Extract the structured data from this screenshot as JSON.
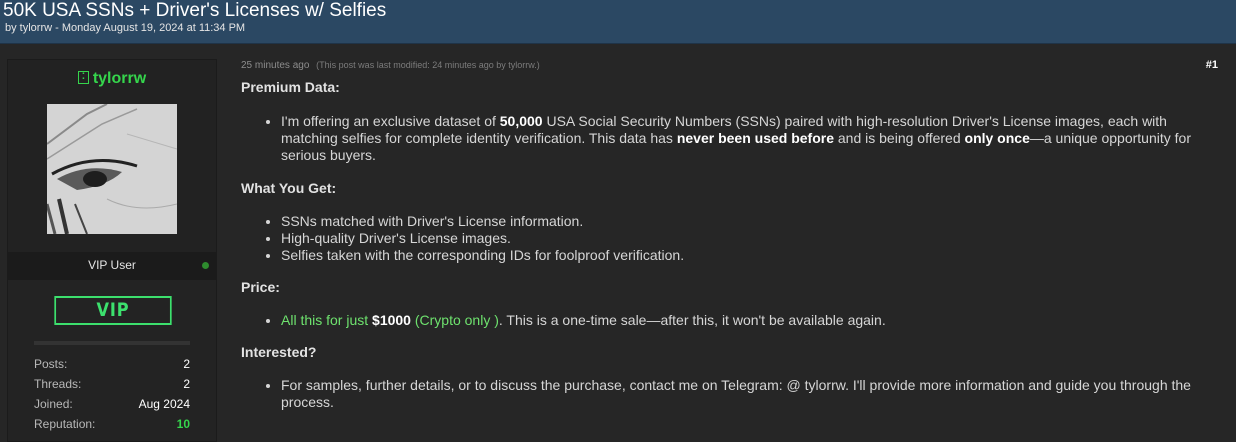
{
  "thread": {
    "title": "50K USA SSNs + Driver's Licenses w/ Selfies",
    "byline": "by tylorrw - Monday August 19, 2024 at 11:34 PM"
  },
  "user": {
    "name": "tylorrw",
    "badge_icon": "vip-mini-icon",
    "rank": "VIP User",
    "vip_badge": "VIP",
    "online_color": "#2e8b2e",
    "stats": [
      {
        "label": "Posts:",
        "value": "2"
      },
      {
        "label": "Threads:",
        "value": "2"
      },
      {
        "label": "Joined:",
        "value": "Aug 2024"
      },
      {
        "label": "Reputation:",
        "value": "10"
      }
    ]
  },
  "post": {
    "time": "25 minutes ago",
    "modified": "(This post was last modified: 24 minutes ago by tylorrw.)",
    "number": "#1",
    "sections": {
      "premium": {
        "heading": "Premium Data:",
        "t1": "I'm offering an exclusive dataset of ",
        "b1": "50,000",
        "t2": " USA Social Security Numbers (SSNs) paired with high-resolution Driver's License images, each with matching selfies for complete identity verification. This data has ",
        "b2": "never been used before",
        "t3": " and is being offered ",
        "b3": "only once",
        "t4": "—a unique opportunity for serious buyers."
      },
      "get": {
        "heading": "What You Get:",
        "items": [
          "SSNs matched with Driver's License information.",
          "High-quality Driver's License images.",
          "Selfies taken with the corresponding IDs for foolproof verification."
        ]
      },
      "price": {
        "heading": "Price:",
        "g1": "All this for just ",
        "amount": "$1000",
        "g2": " (Crypto only )",
        "rest": ". This is a one-time sale—after this, it won't be available again."
      },
      "interested": {
        "heading": "Interested?",
        "text": "For samples, further details, or to discuss the purchase, contact me on Telegram: @ tylorrw. I'll provide more information and guide you through the process."
      }
    }
  },
  "colors": {
    "header_bg": "#2b4863",
    "accent_green": "#35d54c",
    "price_green": "#6ee26e"
  }
}
